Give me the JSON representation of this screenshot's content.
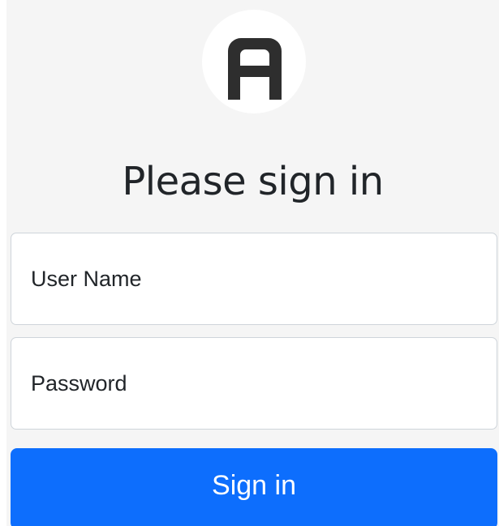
{
  "logo": {
    "icon": "letter-a-logo-icon",
    "color": "#2e2e2e"
  },
  "title": "Please sign in",
  "username": {
    "placeholder": "User Name",
    "value": ""
  },
  "password": {
    "placeholder": "Password",
    "value": ""
  },
  "submit": {
    "label": "Sign in",
    "color": "#0d6efd"
  }
}
